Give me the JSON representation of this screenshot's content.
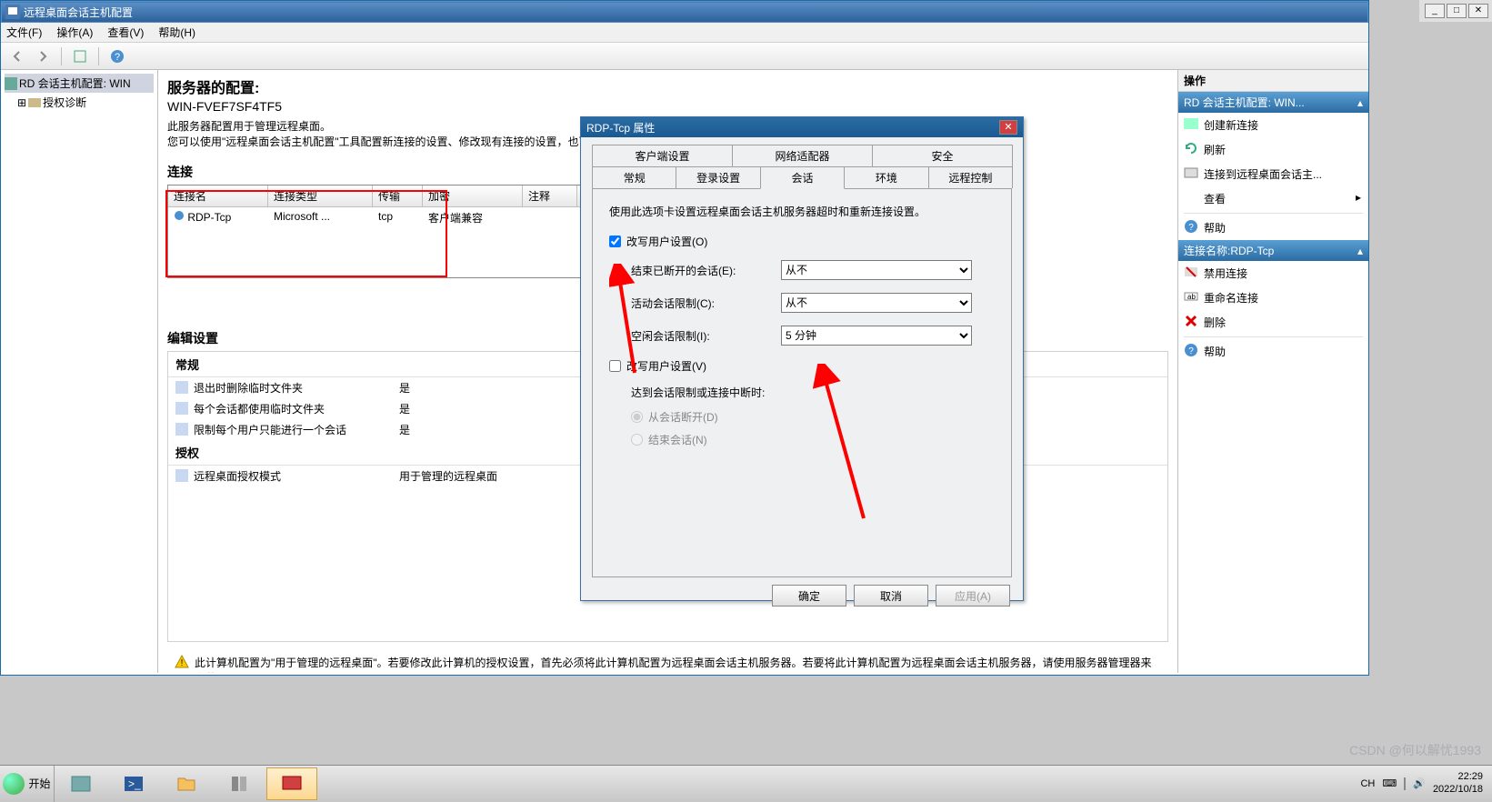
{
  "window": {
    "title": "远程桌面会话主机配置",
    "menus": {
      "file": "文件(F)",
      "action": "操作(A)",
      "view": "查看(V)",
      "help": "帮助(H)"
    }
  },
  "tree": {
    "root": "RD 会话主机配置: WIN",
    "child": "授权诊断"
  },
  "center": {
    "heading": "服务器的配置:",
    "hostname": "WIN-FVEF7SF4TF5",
    "desc1": "此服务器配置用于管理远程桌面。",
    "desc2": "您可以使用\"远程桌面会话主机配置\"工具配置新连接的设置、修改现有连接的设置，也可以将服务器作为整体配置其设置。",
    "conn_label": "连接",
    "cols": {
      "name": "连接名",
      "type": "连接类型",
      "trans": "传输",
      "enc": "加密",
      "rem": "注释"
    },
    "row": {
      "name": "RDP-Tcp",
      "type": "Microsoft ...",
      "trans": "tcp",
      "enc": "客户端兼容",
      "rem": ""
    },
    "edit_label": "编辑设置",
    "general_hdr": "常规",
    "g1": {
      "lbl": "退出时删除临时文件夹",
      "val": "是"
    },
    "g2": {
      "lbl": "每个会话都使用临时文件夹",
      "val": "是"
    },
    "g3": {
      "lbl": "限制每个用户只能进行一个会话",
      "val": "是"
    },
    "auth_hdr": "授权",
    "a1": {
      "lbl": "远程桌面授权模式",
      "val": "用于管理的远程桌面"
    },
    "warn": "此计算机配置为\"用于管理的远程桌面\"。若要修改此计算机的授权设置，首先必须将此计算机配置为远程桌面会话主机服务器。若要将此计算机配置为远程桌面会话主机服务器，请使用服务器管理器来安装远"
  },
  "dialog": {
    "title": "RDP-Tcp 属性",
    "tabs_top": {
      "client": "客户端设置",
      "net": "网络适配器",
      "sec": "安全"
    },
    "tabs_bot": {
      "general": "常规",
      "login": "登录设置",
      "session": "会话",
      "env": "环境",
      "remote": "远程控制"
    },
    "note": "使用此选项卡设置远程桌面会话主机服务器超时和重新连接设置。",
    "chk1": "改写用户设置(O)",
    "fld1": {
      "label": "结束已断开的会话(E):",
      "value": "从不"
    },
    "fld2": {
      "label": "活动会话限制(C):",
      "value": "从不"
    },
    "fld3": {
      "label": "空闲会话限制(I):",
      "value": "5 分钟"
    },
    "chk2": "改写用户设置(V)",
    "sublabel": "达到会话限制或连接中断时:",
    "radio1": "从会话断开(D)",
    "radio2": "结束会话(N)",
    "ok": "确定",
    "cancel": "取消",
    "apply": "应用(A)"
  },
  "actions": {
    "header": "操作",
    "section1": "RD 会话主机配置: WIN... ",
    "a1": "创建新连接",
    "a2": "刷新",
    "a3": "连接到远程桌面会话主...",
    "a4": "查看",
    "a5": "帮助",
    "section2": "连接名称:RDP-Tcp",
    "b1": "禁用连接",
    "b2": "重命名连接",
    "b3": "删除",
    "b4": "帮助"
  },
  "taskbar": {
    "start": "开始",
    "ime": "CH",
    "kbd": "⌨",
    "time": "22:29",
    "date": "2022/10/18"
  },
  "watermark": "CSDN @何以解忧1993"
}
